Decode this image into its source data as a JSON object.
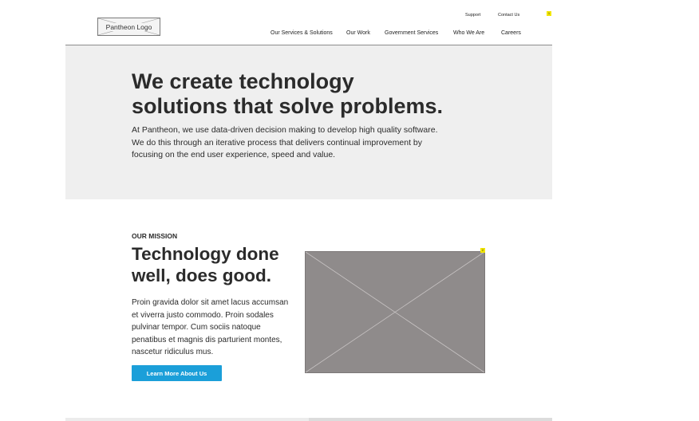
{
  "header": {
    "logo_label": "Pantheon Logo",
    "utility_nav": {
      "support": "Support",
      "contact": "Contact Us"
    },
    "main_nav": {
      "services": "Our Services & Solutions",
      "work": "Our Work",
      "government": "Government Services",
      "who": "Who We Are",
      "careers": "Careers"
    },
    "note_badge": "1"
  },
  "hero": {
    "title_line1": "We create technology",
    "title_line2": "solutions that solve problems.",
    "body": "At Pantheon, we use data-driven decision making to develop high quality software. We do this through an iterative process that delivers continual improvement by focusing on the end user experience, speed and value."
  },
  "mission": {
    "eyebrow": "OUR MISSION",
    "title_line1": "Technology done",
    "title_line2": "well, does good.",
    "body": "Proin gravida dolor sit amet lacus accumsan et viverra justo commodo. Proin sodales pulvinar tempor. Cum sociis natoque penatibus et magnis dis parturient montes, nascetur ridiculus mus.",
    "cta_label": "Learn More About Us",
    "image_badge": "2"
  },
  "colors": {
    "accent": "#1b9fd9",
    "hero_bg": "#efefef",
    "placeholder": "#8f8b8b",
    "note": "#f2e600"
  }
}
